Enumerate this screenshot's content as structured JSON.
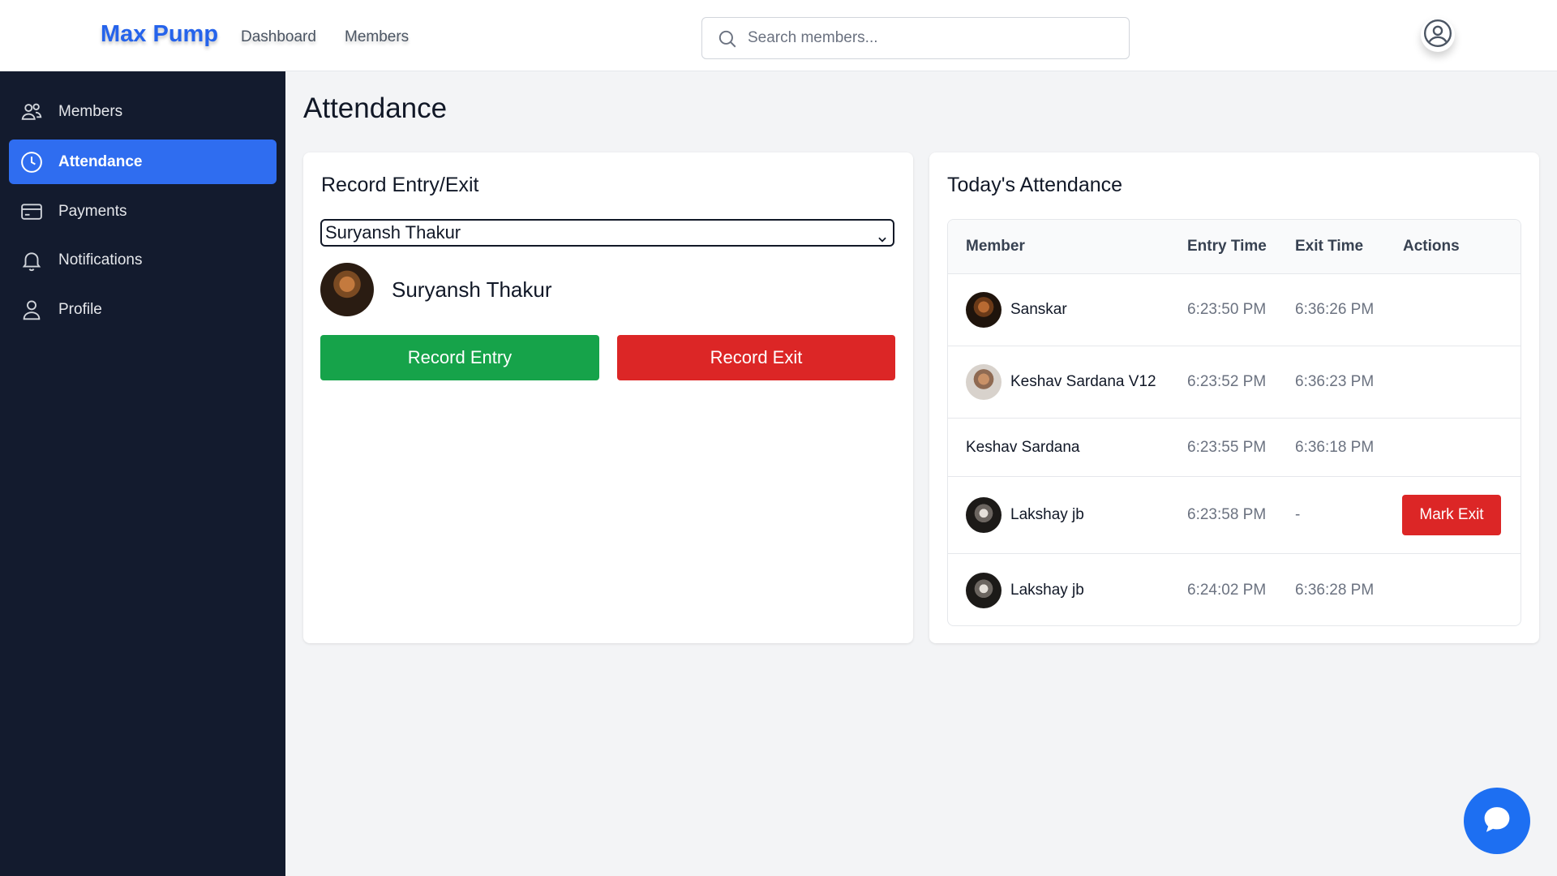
{
  "header": {
    "brand": "Max Pump",
    "nav": [
      {
        "label": "Dashboard"
      },
      {
        "label": "Members"
      }
    ],
    "search_placeholder": "Search members..."
  },
  "sidebar": {
    "items": [
      {
        "label": "Members",
        "icon": "users-icon",
        "active": false
      },
      {
        "label": "Attendance",
        "icon": "clock-icon",
        "active": true
      },
      {
        "label": "Payments",
        "icon": "credit-card-icon",
        "active": false
      },
      {
        "label": "Notifications",
        "icon": "bell-icon",
        "active": false
      },
      {
        "label": "Profile",
        "icon": "user-icon",
        "active": false
      }
    ]
  },
  "main": {
    "title": "Attendance",
    "record": {
      "title": "Record Entry/Exit",
      "selected_member": "Suryansh Thakur",
      "member_name": "Suryansh Thakur",
      "entry_label": "Record Entry",
      "exit_label": "Record Exit"
    },
    "today": {
      "title": "Today's Attendance",
      "columns": [
        "Member",
        "Entry Time",
        "Exit Time",
        "Actions"
      ],
      "rows": [
        {
          "name": "Sanskar",
          "entry": "6:23:50 PM",
          "exit": "6:36:26 PM",
          "action": ""
        },
        {
          "name": "Keshav Sardana V12",
          "entry": "6:23:52 PM",
          "exit": "6:36:23 PM",
          "action": ""
        },
        {
          "name": "Keshav Sardana",
          "entry": "6:23:55 PM",
          "exit": "6:36:18 PM",
          "action": ""
        },
        {
          "name": "Lakshay jb",
          "entry": "6:23:58 PM",
          "exit": "-",
          "action": "Mark Exit"
        },
        {
          "name": "Lakshay jb",
          "entry": "6:24:02 PM",
          "exit": "6:36:28 PM",
          "action": ""
        }
      ]
    }
  },
  "colors": {
    "brand": "#2563eb",
    "sidebar_bg": "#131b2e",
    "active": "#2f6df0",
    "entry": "#16a34a",
    "exit": "#dc2626"
  }
}
